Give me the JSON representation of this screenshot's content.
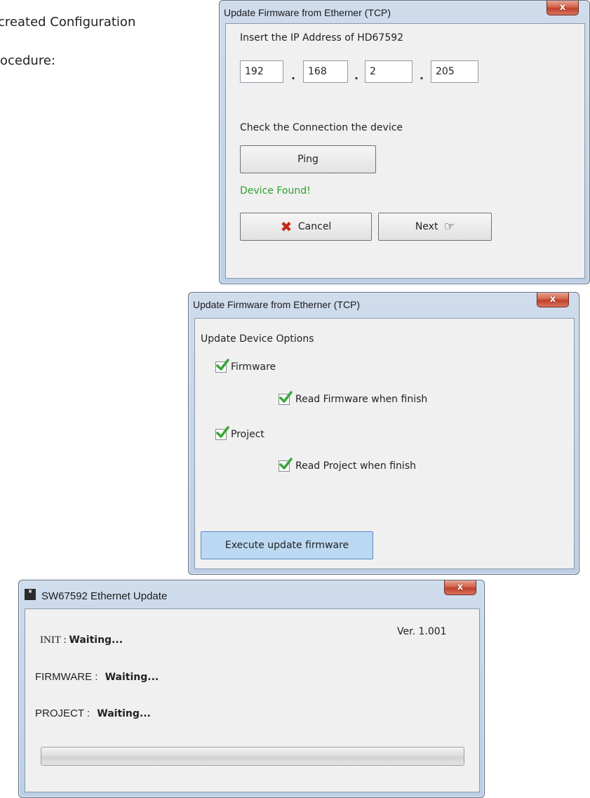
{
  "document": {
    "line1": "created Configuration",
    "line2": "ocedure:"
  },
  "dialog1": {
    "title": "Update Firmware from Etherner (TCP)",
    "close_label": "x",
    "ip_label": "Insert the IP Address of HD67592",
    "ip": [
      "192",
      "168",
      "2",
      "205"
    ],
    "ip_separator": ".",
    "check_label": "Check the Connection the device",
    "ping_label": "Ping",
    "status": "Device Found!",
    "status_color": "#2e9e2e",
    "cancel_label": "Cancel",
    "next_label": "Next"
  },
  "dialog2": {
    "title": "Update Firmware from Etherner (TCP)",
    "close_label": "x",
    "options_label": "Update Device Options",
    "options": [
      {
        "label": "Firmware",
        "checked": true
      },
      {
        "label": "Read Firmware when finish",
        "checked": true
      },
      {
        "label": "Project",
        "checked": true
      },
      {
        "label": "Read Project when finish",
        "checked": true
      }
    ],
    "execute_label": "Execute update firmware",
    "execute_color": "#bcd9f3"
  },
  "dialog3": {
    "title": "SW67592 Ethernet Update",
    "close_label": "x",
    "version": "Ver. 1.001",
    "init_label": "INIT :",
    "init_value": "Waiting...",
    "firmware_label": "FIRMWARE :",
    "firmware_value": "Waiting...",
    "project_label": "PROJECT :",
    "project_value": "Waiting...",
    "progress": 0
  },
  "colors": {
    "check_mark": "#3aa63a",
    "cancel_x": "#c4281c"
  }
}
